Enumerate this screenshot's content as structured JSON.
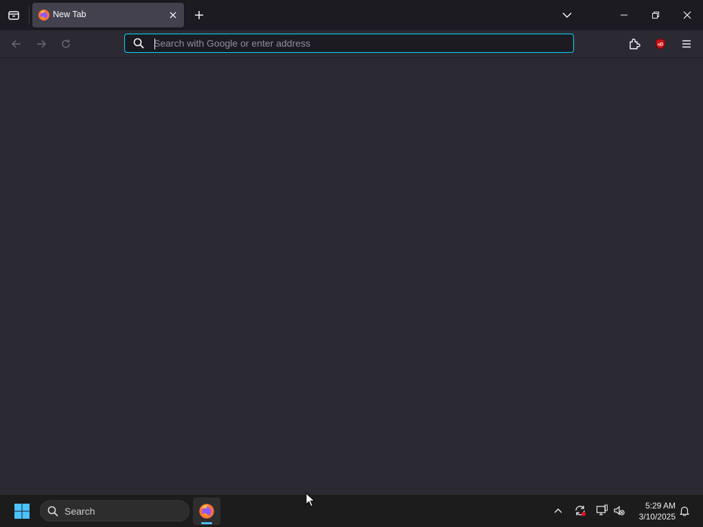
{
  "browser": {
    "tabs": [
      {
        "title": "New Tab",
        "active": true
      }
    ],
    "urlbar": {
      "placeholder": "Search with Google or enter address",
      "value": ""
    },
    "toolbar_icons": [
      "back-arrow-icon",
      "forward-arrow-icon",
      "reload-icon",
      "extensions-icon",
      "ublock-origin-icon",
      "hamburger-menu-icon"
    ],
    "colors": {
      "frame": "#1c1b22",
      "toolbar": "#2b2a33",
      "tab_active": "#42414d",
      "focus_ring": "#00ddff",
      "content": "#2b2a33"
    }
  },
  "taskbar": {
    "search_label": "Search",
    "pinned_apps": [
      "firefox-icon"
    ],
    "clock": {
      "time": "5:29 AM",
      "date": "3/10/2025"
    },
    "accent": "#4cc2ff"
  }
}
